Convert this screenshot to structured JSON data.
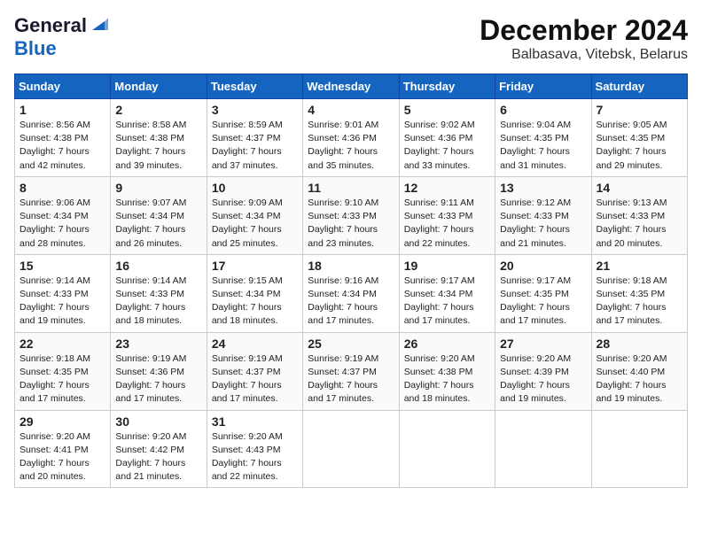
{
  "header": {
    "logo_line1": "General",
    "logo_line2": "Blue",
    "title": "December 2024",
    "subtitle": "Balbasava, Vitebsk, Belarus"
  },
  "days_of_week": [
    "Sunday",
    "Monday",
    "Tuesday",
    "Wednesday",
    "Thursday",
    "Friday",
    "Saturday"
  ],
  "weeks": [
    [
      {
        "day": 1,
        "sunrise": "8:56 AM",
        "sunset": "4:38 PM",
        "daylight": "7 hours and 42 minutes."
      },
      {
        "day": 2,
        "sunrise": "8:58 AM",
        "sunset": "4:38 PM",
        "daylight": "7 hours and 39 minutes."
      },
      {
        "day": 3,
        "sunrise": "8:59 AM",
        "sunset": "4:37 PM",
        "daylight": "7 hours and 37 minutes."
      },
      {
        "day": 4,
        "sunrise": "9:01 AM",
        "sunset": "4:36 PM",
        "daylight": "7 hours and 35 minutes."
      },
      {
        "day": 5,
        "sunrise": "9:02 AM",
        "sunset": "4:36 PM",
        "daylight": "7 hours and 33 minutes."
      },
      {
        "day": 6,
        "sunrise": "9:04 AM",
        "sunset": "4:35 PM",
        "daylight": "7 hours and 31 minutes."
      },
      {
        "day": 7,
        "sunrise": "9:05 AM",
        "sunset": "4:35 PM",
        "daylight": "7 hours and 29 minutes."
      }
    ],
    [
      {
        "day": 8,
        "sunrise": "9:06 AM",
        "sunset": "4:34 PM",
        "daylight": "7 hours and 28 minutes."
      },
      {
        "day": 9,
        "sunrise": "9:07 AM",
        "sunset": "4:34 PM",
        "daylight": "7 hours and 26 minutes."
      },
      {
        "day": 10,
        "sunrise": "9:09 AM",
        "sunset": "4:34 PM",
        "daylight": "7 hours and 25 minutes."
      },
      {
        "day": 11,
        "sunrise": "9:10 AM",
        "sunset": "4:33 PM",
        "daylight": "7 hours and 23 minutes."
      },
      {
        "day": 12,
        "sunrise": "9:11 AM",
        "sunset": "4:33 PM",
        "daylight": "7 hours and 22 minutes."
      },
      {
        "day": 13,
        "sunrise": "9:12 AM",
        "sunset": "4:33 PM",
        "daylight": "7 hours and 21 minutes."
      },
      {
        "day": 14,
        "sunrise": "9:13 AM",
        "sunset": "4:33 PM",
        "daylight": "7 hours and 20 minutes."
      }
    ],
    [
      {
        "day": 15,
        "sunrise": "9:14 AM",
        "sunset": "4:33 PM",
        "daylight": "7 hours and 19 minutes."
      },
      {
        "day": 16,
        "sunrise": "9:14 AM",
        "sunset": "4:33 PM",
        "daylight": "7 hours and 18 minutes."
      },
      {
        "day": 17,
        "sunrise": "9:15 AM",
        "sunset": "4:34 PM",
        "daylight": "7 hours and 18 minutes."
      },
      {
        "day": 18,
        "sunrise": "9:16 AM",
        "sunset": "4:34 PM",
        "daylight": "7 hours and 17 minutes."
      },
      {
        "day": 19,
        "sunrise": "9:17 AM",
        "sunset": "4:34 PM",
        "daylight": "7 hours and 17 minutes."
      },
      {
        "day": 20,
        "sunrise": "9:17 AM",
        "sunset": "4:35 PM",
        "daylight": "7 hours and 17 minutes."
      },
      {
        "day": 21,
        "sunrise": "9:18 AM",
        "sunset": "4:35 PM",
        "daylight": "7 hours and 17 minutes."
      }
    ],
    [
      {
        "day": 22,
        "sunrise": "9:18 AM",
        "sunset": "4:35 PM",
        "daylight": "7 hours and 17 minutes."
      },
      {
        "day": 23,
        "sunrise": "9:19 AM",
        "sunset": "4:36 PM",
        "daylight": "7 hours and 17 minutes."
      },
      {
        "day": 24,
        "sunrise": "9:19 AM",
        "sunset": "4:37 PM",
        "daylight": "7 hours and 17 minutes."
      },
      {
        "day": 25,
        "sunrise": "9:19 AM",
        "sunset": "4:37 PM",
        "daylight": "7 hours and 17 minutes."
      },
      {
        "day": 26,
        "sunrise": "9:20 AM",
        "sunset": "4:38 PM",
        "daylight": "7 hours and 18 minutes."
      },
      {
        "day": 27,
        "sunrise": "9:20 AM",
        "sunset": "4:39 PM",
        "daylight": "7 hours and 19 minutes."
      },
      {
        "day": 28,
        "sunrise": "9:20 AM",
        "sunset": "4:40 PM",
        "daylight": "7 hours and 19 minutes."
      }
    ],
    [
      {
        "day": 29,
        "sunrise": "9:20 AM",
        "sunset": "4:41 PM",
        "daylight": "7 hours and 20 minutes."
      },
      {
        "day": 30,
        "sunrise": "9:20 AM",
        "sunset": "4:42 PM",
        "daylight": "7 hours and 21 minutes."
      },
      {
        "day": 31,
        "sunrise": "9:20 AM",
        "sunset": "4:43 PM",
        "daylight": "7 hours and 22 minutes."
      },
      null,
      null,
      null,
      null
    ]
  ]
}
